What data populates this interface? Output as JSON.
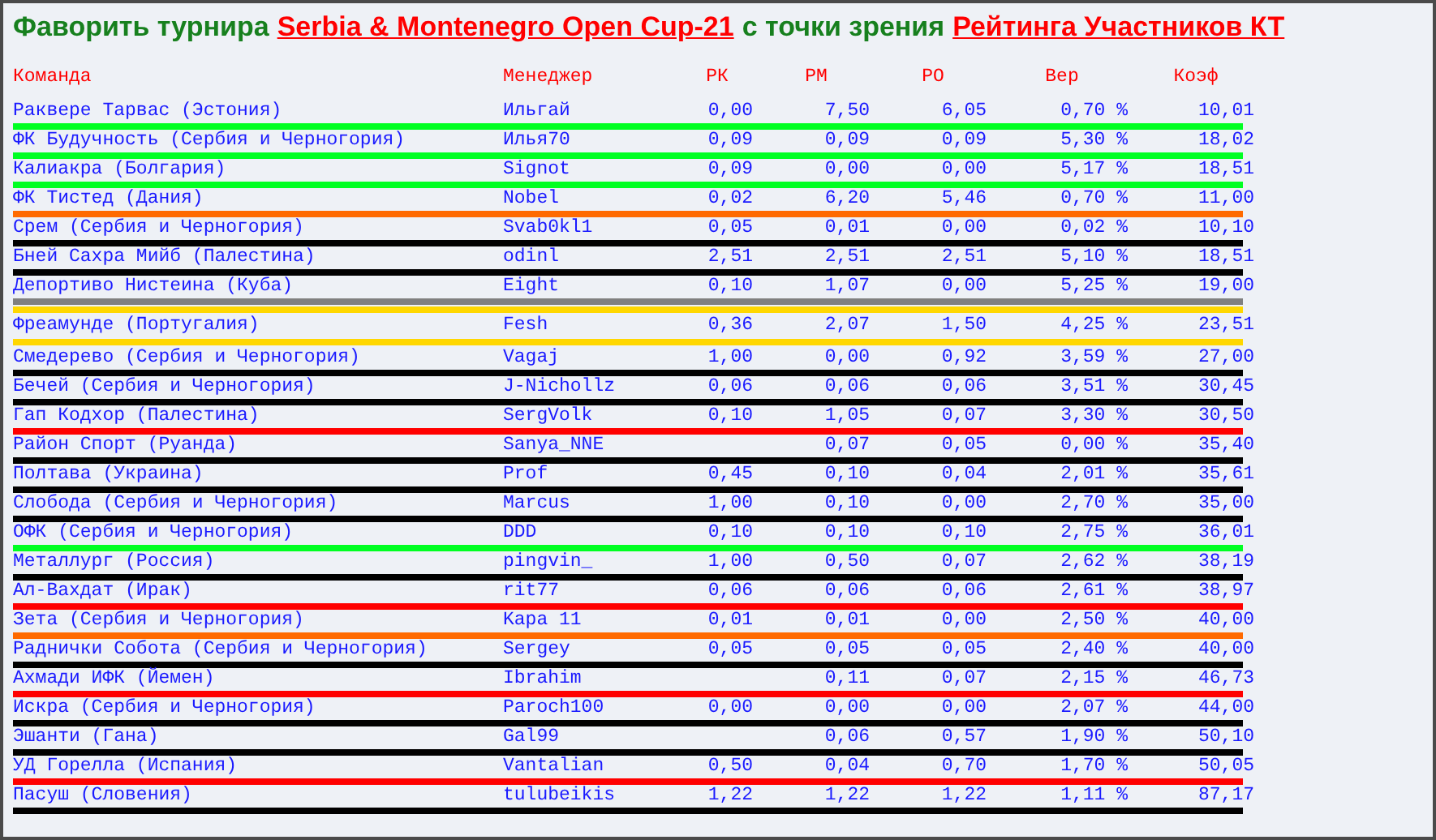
{
  "title": [
    {
      "kind": "plain",
      "text": "Фаворить турнира"
    },
    {
      "kind": "link",
      "text": "Serbia & Montenegro Open Cup-21"
    },
    {
      "kind": "plain",
      "text": "с точки зрения"
    },
    {
      "kind": "link",
      "text": "Рейтинга Участников КТ"
    }
  ],
  "table": {
    "columns": [
      "Команда",
      "Менеджер",
      "РК",
      "РМ",
      "РО",
      "Вер",
      "Коэф"
    ],
    "rows": [
      {
        "kind": "struck",
        "color": "#00ff22",
        "cells": [
          "Раквере Тарвас (Эстония)",
          "Ильгай",
          "0,00",
          "7,50",
          "6,05",
          "0,70 %",
          "10,01"
        ]
      },
      {
        "kind": "struck",
        "color": "#00ff22",
        "cells": [
          "ФК Будучность (Сербия и Черногория)",
          "Илья70",
          "0,09",
          "0,09",
          "0,09",
          "5,30 %",
          "18,02"
        ]
      },
      {
        "kind": "struck",
        "color": "#00ff22",
        "cells": [
          "Калиакра (Болгария)",
          "Signot",
          "0,09",
          "0,00",
          "0,00",
          "5,17 %",
          "18,51"
        ]
      },
      {
        "kind": "struck",
        "color": "#ff6a00",
        "cells": [
          "ФК Тистед (Дания)",
          "Nobel",
          "0,02",
          "6,20",
          "5,46",
          "0,70 %",
          "11,00"
        ]
      },
      {
        "kind": "struck",
        "color": "#000000",
        "cells": [
          "Срем (Сербия и Черногория)",
          "Svab0kl1",
          "0,05",
          "0,01",
          "0,00",
          "0,02 %",
          "10,10"
        ]
      },
      {
        "kind": "struck",
        "color": "#000000",
        "cells": [
          "Бней Сахра Мийб (Палестина)",
          "odinl",
          "2,51",
          "2,51",
          "2,51",
          "5,10 %",
          "18,51"
        ]
      },
      {
        "kind": "struck",
        "color": "#808080",
        "cells": [
          "Депортиво Нистеина (Куба)",
          "Eight",
          "0,10",
          "1,07",
          "0,00",
          "5,25 %",
          "19,00"
        ]
      },
      {
        "kind": "highlighted",
        "color": "#ffd700",
        "cells": [
          "Фреамунде (Португалия)",
          "Fesh",
          "0,36",
          "2,07",
          "1,50",
          "4,25 %",
          "23,51"
        ]
      },
      {
        "kind": "struck",
        "color": "#000000",
        "cells": [
          "Смедерево (Сербия и Черногория)",
          "Vagaj",
          "1,00",
          "0,00",
          "0,92",
          "3,59 %",
          "27,00"
        ]
      },
      {
        "kind": "struck",
        "color": "#000000",
        "cells": [
          "Бечей (Сербия и Черногория)",
          "J-Nichollz",
          "0,06",
          "0,06",
          "0,06",
          "3,51 %",
          "30,45"
        ]
      },
      {
        "kind": "struck",
        "color": "#ff0000",
        "cells": [
          "Гап Кодхор (Палестина)",
          "SergVolk",
          "0,10",
          "1,05",
          "0,07",
          "3,30 %",
          "30,50"
        ]
      },
      {
        "kind": "struck",
        "color": "#000000",
        "cells": [
          "Район Спорт (Руанда)",
          "Sanya_NNE",
          "",
          "0,07",
          "0,05",
          "0,00 %",
          "35,40"
        ]
      },
      {
        "kind": "struck",
        "color": "#000000",
        "cells": [
          "Полтава (Украина)",
          "Prof",
          "0,45",
          "0,10",
          "0,04",
          "2,01 %",
          "35,61"
        ]
      },
      {
        "kind": "struck",
        "color": "#000000",
        "cells": [
          "Слобода (Сербия и Черногория)",
          "Marcus",
          "1,00",
          "0,10",
          "0,00",
          "2,70 %",
          "35,00"
        ]
      },
      {
        "kind": "struck",
        "color": "#00ff22",
        "cells": [
          "ОФК (Сербия и Черногория)",
          "DDD",
          "0,10",
          "0,10",
          "0,10",
          "2,75 %",
          "36,01"
        ]
      },
      {
        "kind": "struck",
        "color": "#000000",
        "cells": [
          "Металлург (Россия)",
          "pingvin_",
          "1,00",
          "0,50",
          "0,07",
          "2,62 %",
          "38,19"
        ]
      },
      {
        "kind": "struck",
        "color": "#ff0000",
        "cells": [
          "Ал-Вахдат (Ирак)",
          "rit77",
          "0,06",
          "0,06",
          "0,06",
          "2,61 %",
          "38,97"
        ]
      },
      {
        "kind": "struck",
        "color": "#ff6a00",
        "cells": [
          "Зета (Сербия и Черногория)",
          "Kapa 11",
          "0,01",
          "0,01",
          "0,00",
          "2,50 %",
          "40,00"
        ]
      },
      {
        "kind": "struck",
        "color": "#000000",
        "cells": [
          "Раднички Собота (Сербия и Черногория)",
          "Sergey",
          "0,05",
          "0,05",
          "0,05",
          "2,40 %",
          "40,00"
        ]
      },
      {
        "kind": "struck",
        "color": "#ff0000",
        "cells": [
          "Ахмади ИФК (Йемен)",
          "Ibrahim",
          "",
          "0,11",
          "0,07",
          "2,15 %",
          "46,73"
        ]
      },
      {
        "kind": "struck",
        "color": "#000000",
        "cells": [
          "Искра (Сербия и Черногория)",
          "Paroch100",
          "0,00",
          "0,00",
          "0,00",
          "2,07 %",
          "44,00"
        ]
      },
      {
        "kind": "struck",
        "color": "#000000",
        "cells": [
          "Эшанти (Гана)",
          "Gal99",
          "",
          "0,06",
          "0,57",
          "1,90 %",
          "50,10"
        ]
      },
      {
        "kind": "struck",
        "color": "#ff0000",
        "cells": [
          "УД Горелла (Испания)",
          "Vantalian",
          "0,50",
          "0,04",
          "0,70",
          "1,70 %",
          "50,05"
        ]
      },
      {
        "kind": "struck",
        "color": "#000000",
        "cells": [
          "Пасуш (Словения)",
          "tulubeikis",
          "1,22",
          "1,22",
          "1,22",
          "1,11 %",
          "87,17"
        ]
      }
    ]
  }
}
